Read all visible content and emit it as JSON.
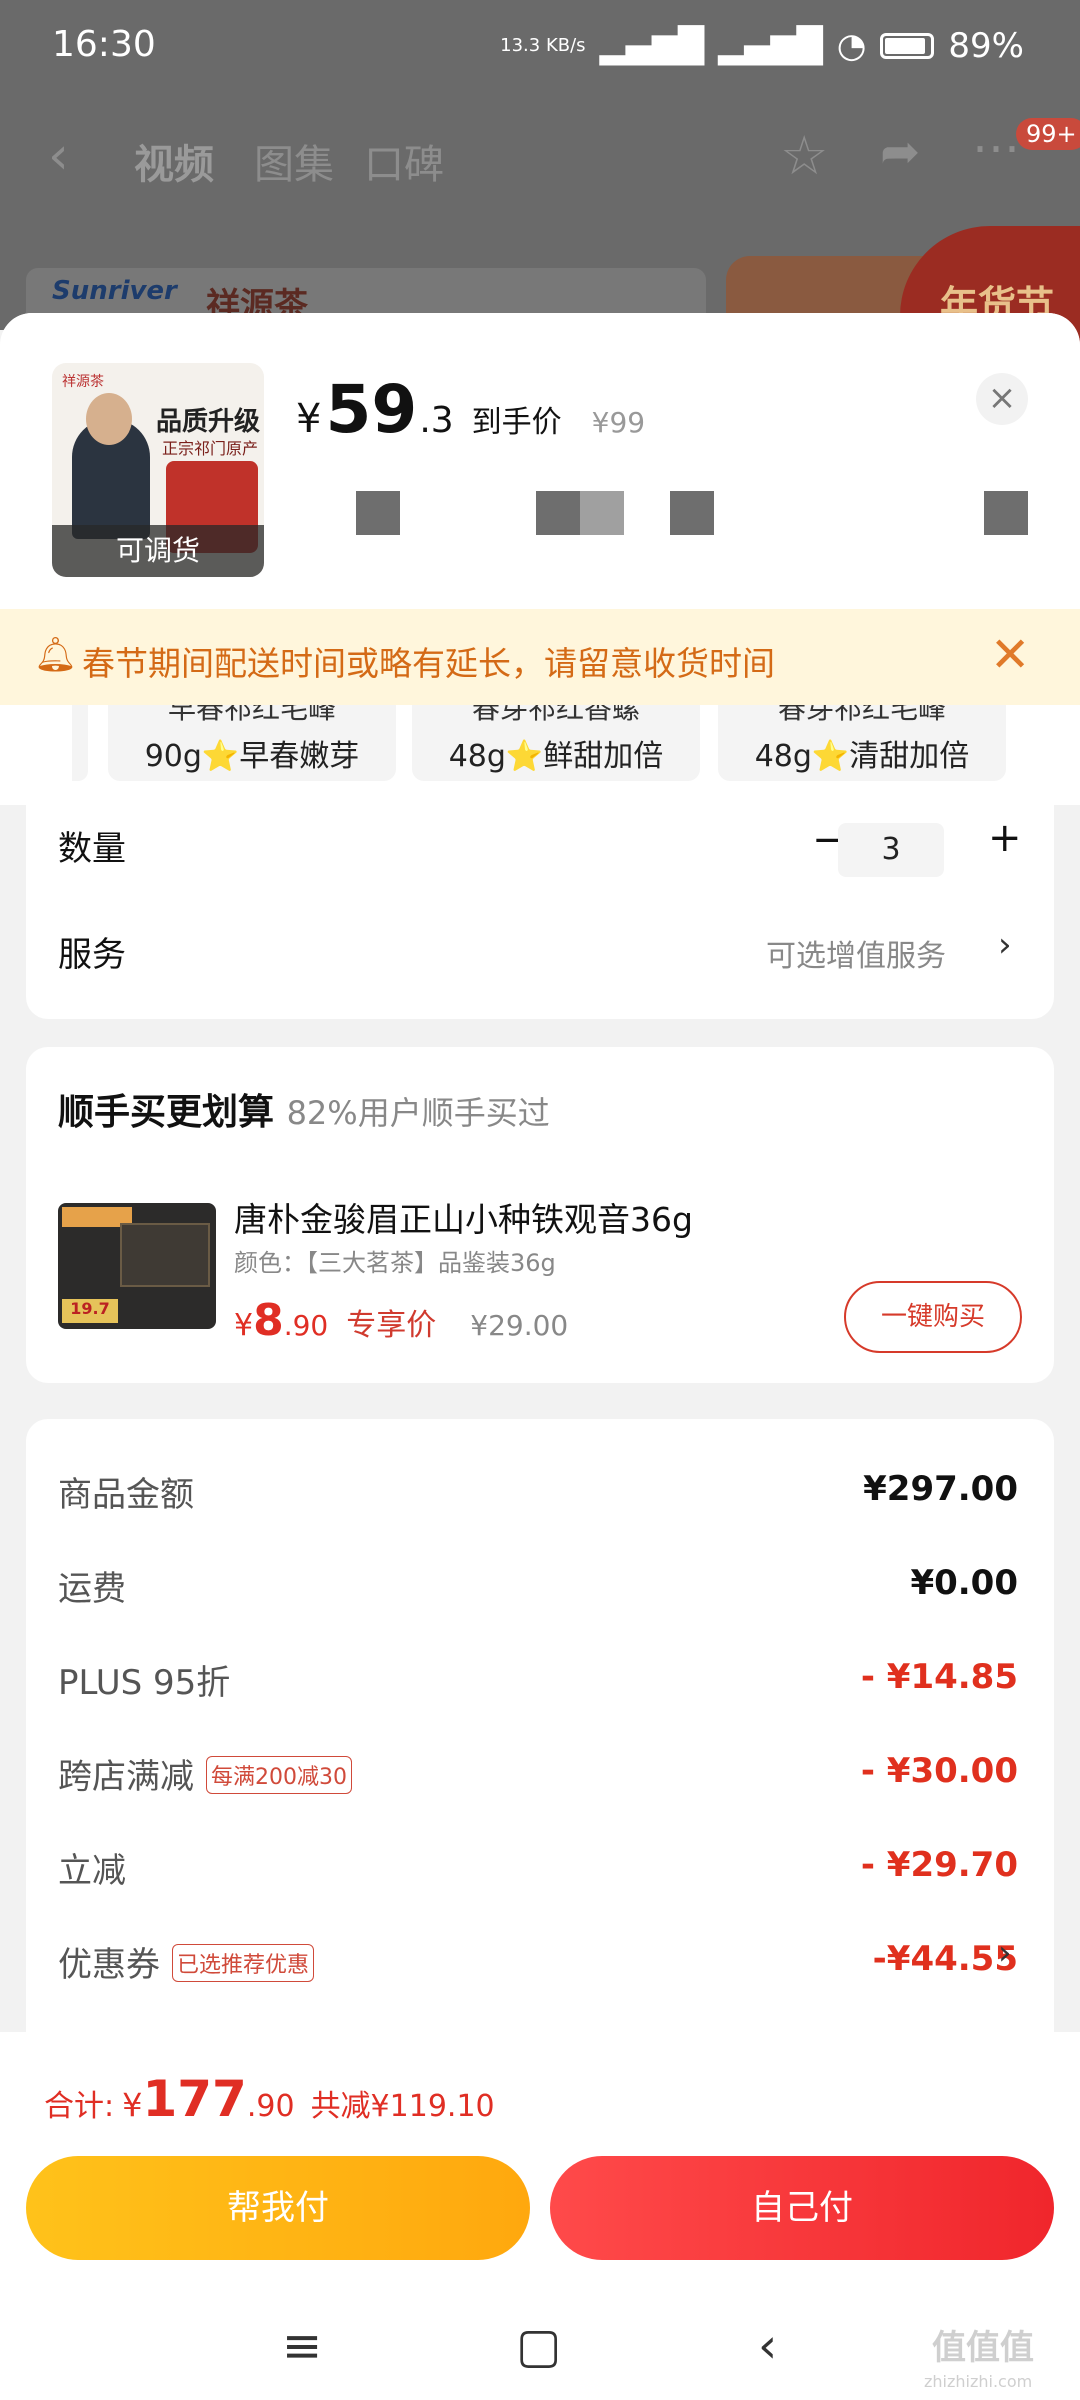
{
  "status": {
    "time": "16:30",
    "net_speed": "13.3 KB/s",
    "signal1": "HD",
    "signal2": "HD",
    "battery": "89%"
  },
  "header": {
    "tabs": [
      "视频",
      "图集",
      "口碑"
    ],
    "badge": "99+"
  },
  "brand": {
    "logo1": "Sunriver",
    "logo2": "祥源茶",
    "promo": "年货节"
  },
  "product": {
    "thumb_brand": "祥源茶",
    "thumb_title": "品质升级",
    "thumb_sub": "正宗祁门原产",
    "thumb_caption": "可调货",
    "price_symbol": "¥",
    "price_int": "59",
    "price_dec": ".3",
    "price_label": "到手价",
    "orig_price": "¥99",
    "close": "×"
  },
  "notice": {
    "text": "春节期间配送时间或略有延长，请留意收货时间",
    "close": "✕"
  },
  "specs": [
    {
      "top": "早春祁红毛峰",
      "main": "90g⭐早春嫩芽"
    },
    {
      "top": "春芽祁红香螺",
      "main": "48g⭐鲜甜加倍"
    },
    {
      "top": "春芽祁红毛峰",
      "main": "48g⭐清甜加倍"
    }
  ],
  "quantity": {
    "label": "数量",
    "minus": "−",
    "value": "3",
    "plus": "+"
  },
  "service": {
    "label": "服务",
    "value": "可选增值服务",
    "chevron": "›"
  },
  "addon": {
    "title": "顺手买更划算",
    "subtitle": "82%用户顺手买过",
    "item_title": "唐朴金骏眉正山小种铁观音36g",
    "item_color": "颜色：【三大茗茶】品鉴装36g",
    "price_symbol": "¥",
    "price_int": "8",
    "price_dec": ".90",
    "price_tag": "专享价",
    "orig_price": "¥29.00",
    "buy_button": "一键购买",
    "img_price": "19.7"
  },
  "summary": {
    "rows": [
      {
        "label": "商品金额",
        "value": "¥297.00"
      },
      {
        "label": "运费",
        "value": "¥0.00"
      },
      {
        "label": "PLUS 95折",
        "value": "- ¥14.85"
      },
      {
        "label": "跨店满减",
        "chip": "每满200减30",
        "value": "- ¥30.00"
      },
      {
        "label": "立减",
        "value": "- ¥29.70"
      },
      {
        "label": "优惠券",
        "chip": "已选推荐优惠",
        "value": "-¥44.55",
        "chevron": "›"
      }
    ]
  },
  "total": {
    "label": "合计:",
    "symbol": "¥",
    "int": "177",
    "dec": ".90",
    "saved": "共减¥119.10"
  },
  "actions": {
    "help_pay": "帮我付",
    "self_pay": "自己付"
  },
  "watermark": {
    "main": "值值值",
    "sub": "zhizhizhi.com"
  }
}
